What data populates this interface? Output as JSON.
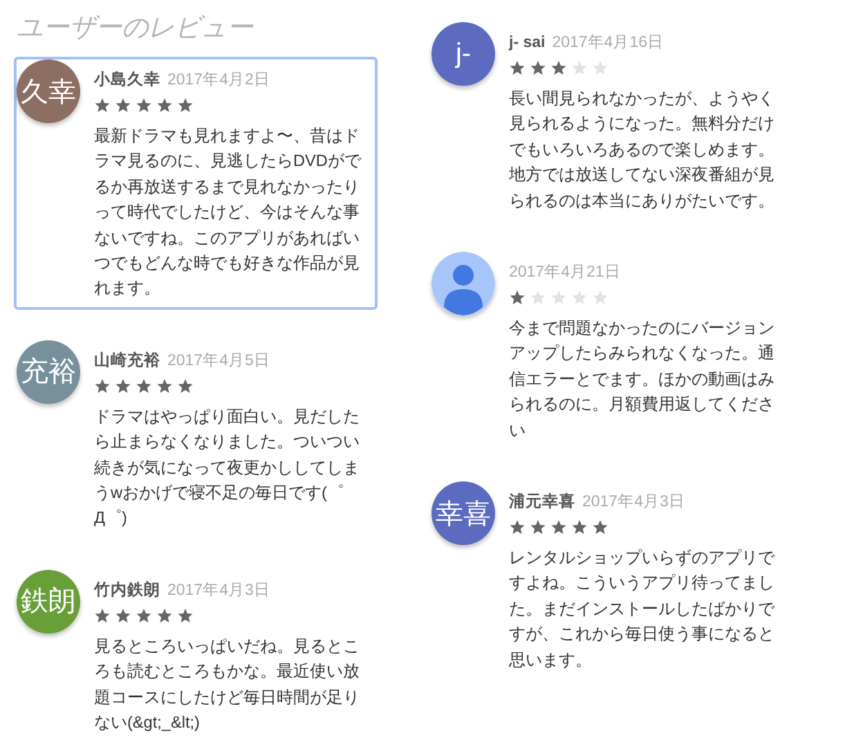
{
  "title": "ユーザーのレビュー",
  "columns": [
    {
      "reviews": [
        {
          "avatar": {
            "kind": "initials",
            "text": "久幸",
            "color": "#8d6e63"
          },
          "name": "小島久幸",
          "date": "2017年4月2日",
          "stars": 5,
          "selected": true,
          "text": "最新ドラマも見れますよ〜、昔はドラマ見るのに、見逃したらDVDがでるか再放送するまで見れなかったりって時代でしたけど、今はそんな事ないですね。このアプリがあればいつでもどんな時でも好きな作品が見れます。"
        },
        {
          "avatar": {
            "kind": "initials",
            "text": "充裕",
            "color": "#78909c"
          },
          "name": "山崎充裕",
          "date": "2017年4月5日",
          "stars": 5,
          "selected": false,
          "text": "ドラマはやっぱり面白い。見だしたら止まらなくなりました。ついつい続きが気になって夜更かししてしまうwおかげで寝不足の毎日です(゜Д゜)"
        },
        {
          "avatar": {
            "kind": "initials",
            "text": "鉄朗",
            "color": "#689f38"
          },
          "name": "竹内鉄朗",
          "date": "2017年4月3日",
          "stars": 5,
          "selected": false,
          "text": "見るところいっぱいだね。見るところも読むところもかな。最近使い放題コースにしたけど毎日時間が足りない(&gt;_&lt;)"
        }
      ]
    },
    {
      "reviews": [
        {
          "avatar": {
            "kind": "initials",
            "text": "j-",
            "color": "#5c6bc0"
          },
          "name": "j- sai",
          "date": "2017年4月16日",
          "stars": 3,
          "selected": false,
          "text": "長い間見られなかったが、ようやく見られるようになった。無料分だけでもいろいろあるので楽しめます。地方では放送してない深夜番組が見られるのは本当にありがたいです。"
        },
        {
          "avatar": {
            "kind": "silhouette",
            "color": "#a7c5fb"
          },
          "date": "2017年4月21日",
          "stars": 1,
          "selected": false,
          "text": "今まで問題なかったのにバージョンアップしたらみられなくなった。通信エラーとでます。ほかの動画はみられるのに。月額費用返してください"
        },
        {
          "avatar": {
            "kind": "initials",
            "text": "幸喜",
            "color": "#5c6bc0"
          },
          "name": "浦元幸喜",
          "date": "2017年4月3日",
          "stars": 5,
          "selected": false,
          "text": "レンタルショップいらずのアプリですよね。こういうアプリ待ってました。まだインストールしたばかりですが、これから毎日使う事になると思います。"
        }
      ]
    }
  ]
}
